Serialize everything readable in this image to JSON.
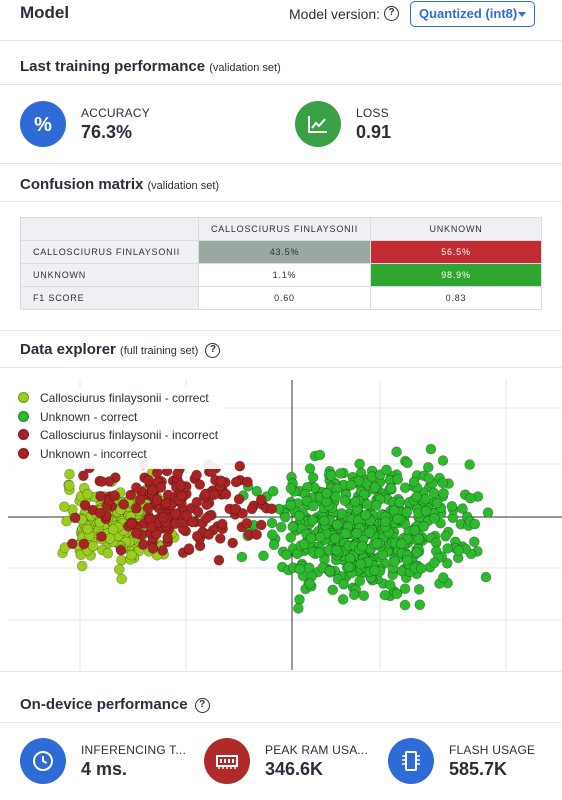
{
  "header": {
    "title": "Model",
    "model_version_label": "Model version:",
    "model_version_value": "Quantized (int8)"
  },
  "training": {
    "title": "Last training performance",
    "subtitle": "(validation set)",
    "accuracy": {
      "label": "ACCURACY",
      "value": "76.3%",
      "icon": "percent-icon",
      "color": "#2f6bd6"
    },
    "loss": {
      "label": "LOSS",
      "value": "0.91",
      "icon": "trend-chart-icon",
      "color": "#3aa046"
    }
  },
  "confusion": {
    "title": "Confusion matrix",
    "subtitle": "(validation set)",
    "columns": [
      "CALLOSCIURUS FINLAYSONII",
      "UNKNOWN"
    ],
    "rows": [
      {
        "label": "CALLOSCIURUS FINLAYSONII",
        "cells": [
          "43.5%",
          "56.5%"
        ]
      },
      {
        "label": "UNKNOWN",
        "cells": [
          "1.1%",
          "98.9%"
        ]
      },
      {
        "label": "F1 SCORE",
        "cells": [
          "0.60",
          "0.83"
        ]
      }
    ]
  },
  "explorer": {
    "title": "Data explorer",
    "subtitle": "(full training set)",
    "legend": [
      {
        "label": "Callosciurus finlaysonii - correct",
        "color": "#9acd1f"
      },
      {
        "label": "Unknown - correct",
        "color": "#2eb82e"
      },
      {
        "label": "Callosciurus finlaysonii - incorrect",
        "color": "#a82424"
      },
      {
        "label": "Unknown - incorrect",
        "color": "#a82424"
      }
    ]
  },
  "chart_data": {
    "type": "scatter",
    "title": "",
    "xlabel": "",
    "ylabel": "",
    "grid": true,
    "legend_placement": "top-left",
    "series": [
      {
        "name": "Callosciurus finlaysonii - correct",
        "color": "#9acd1f",
        "points": "clustered on the left side"
      },
      {
        "name": "Unknown - correct",
        "color": "#2eb82e",
        "points": "dense cluster center and right"
      },
      {
        "name": "Callosciurus finlaysonii - incorrect",
        "color": "#a82424",
        "points": "mixed in left/center"
      },
      {
        "name": "Unknown - incorrect",
        "color": "#a82424",
        "points": "mixed in left/center"
      }
    ]
  },
  "on_device": {
    "title": "On-device performance",
    "inferencing": {
      "label": "INFERENCING T...",
      "value": "4 ms.",
      "icon": "clock-icon",
      "color": "#2f6bd6"
    },
    "ram": {
      "label": "PEAK RAM USA...",
      "value": "346.6K",
      "icon": "ram-chip-icon",
      "color": "#b02a2a"
    },
    "flash": {
      "label": "FLASH USAGE",
      "value": "585.7K",
      "icon": "flash-chip-icon",
      "color": "#2f6bd6"
    }
  }
}
